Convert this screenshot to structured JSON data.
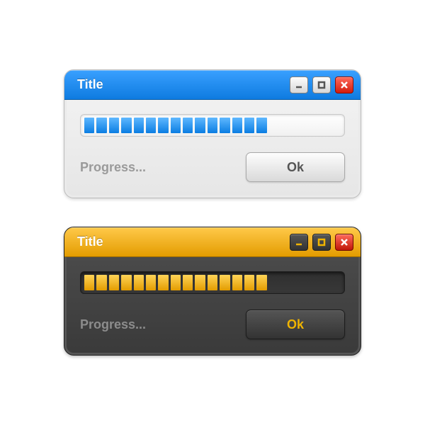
{
  "windows": [
    {
      "theme": "light",
      "title": "Title",
      "status": "Progress...",
      "ok_label": "Ok",
      "progress": {
        "filled": 15,
        "total": 21
      },
      "accent": "#1c86e8"
    },
    {
      "theme": "dark",
      "title": "Title",
      "status": "Progress...",
      "ok_label": "Ok",
      "progress": {
        "filled": 15,
        "total": 21
      },
      "accent": "#f0a800"
    }
  ]
}
